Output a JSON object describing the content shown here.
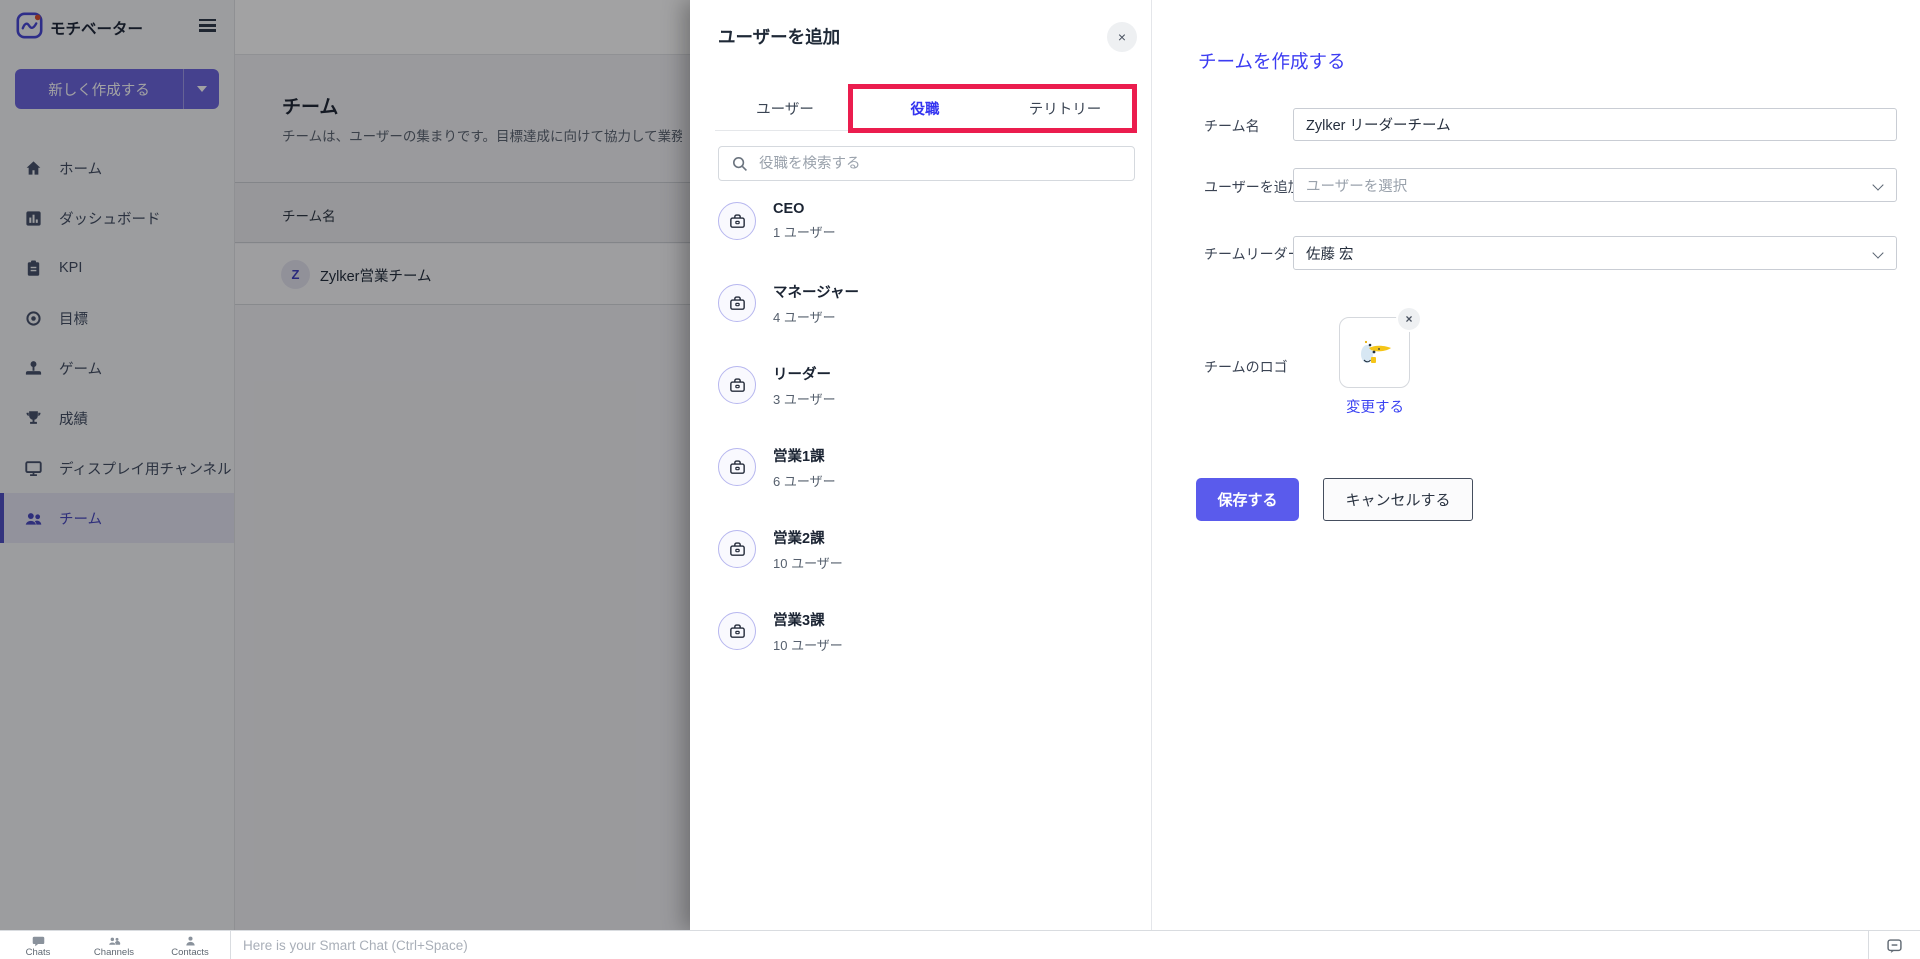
{
  "colors": {
    "accent_purple": "#6a63de",
    "save_button_purple": "#5a5bec",
    "form_title_blue": "#3c3cf2",
    "annotation_red": "#eb1d4e",
    "sidebar_active_purple": "#4646bf",
    "logo_dot_red": "#da4b2b"
  },
  "sidebar": {
    "app_name": "モチベーター",
    "create_button_label": "新しく作成する",
    "items": [
      {
        "label": "ホーム"
      },
      {
        "label": "ダッシュボード"
      },
      {
        "label": "KPI"
      },
      {
        "label": "目標"
      },
      {
        "label": "ゲーム"
      },
      {
        "label": "成績"
      },
      {
        "label": "ディスプレイ用チャンネル"
      },
      {
        "label": "チーム"
      }
    ],
    "active_item": "チーム"
  },
  "main": {
    "page_title": "チーム",
    "page_description": "チームは、ユーザーの集まりです。目標達成に向けて協力して業務を行",
    "table": {
      "header": "チーム名",
      "rows": [
        {
          "avatar_letter": "Z",
          "name": "Zylker営業チーム"
        }
      ]
    }
  },
  "add_users_panel": {
    "title": "ユーザーを追加",
    "close_label": "×",
    "tabs": [
      {
        "label": "ユーザー"
      },
      {
        "label": "役職"
      },
      {
        "label": "テリトリー"
      }
    ],
    "active_tab": "役職",
    "search_placeholder": "役職を検索する",
    "roles": [
      {
        "name": "CEO",
        "count": "1 ユーザー"
      },
      {
        "name": "マネージャー",
        "count": "4 ユーザー"
      },
      {
        "name": "リーダー",
        "count": "3 ユーザー"
      },
      {
        "name": "営業1課",
        "count": "6 ユーザー"
      },
      {
        "name": "営業2課",
        "count": "10 ユーザー"
      },
      {
        "name": "営業3課",
        "count": "10 ユーザー"
      }
    ]
  },
  "create_team_form": {
    "title": "チームを作成する",
    "fields": {
      "team_name": {
        "label": "チーム名",
        "value": "Zylker リーダーチーム"
      },
      "add_users": {
        "label": "ユーザーを追加",
        "placeholder": "ユーザーを選択"
      },
      "team_leader": {
        "label": "チームリーダー",
        "value": "佐藤 宏"
      },
      "team_logo": {
        "label": "チームのロゴ",
        "change_link": "変更する",
        "remove_label": "×"
      }
    },
    "save_button": "保存する",
    "cancel_button": "キャンセルする"
  },
  "bottom_bar": {
    "items": [
      {
        "label": "Chats"
      },
      {
        "label": "Channels"
      },
      {
        "label": "Contacts"
      }
    ],
    "chat_placeholder": "Here is your Smart Chat (Ctrl+Space)"
  }
}
